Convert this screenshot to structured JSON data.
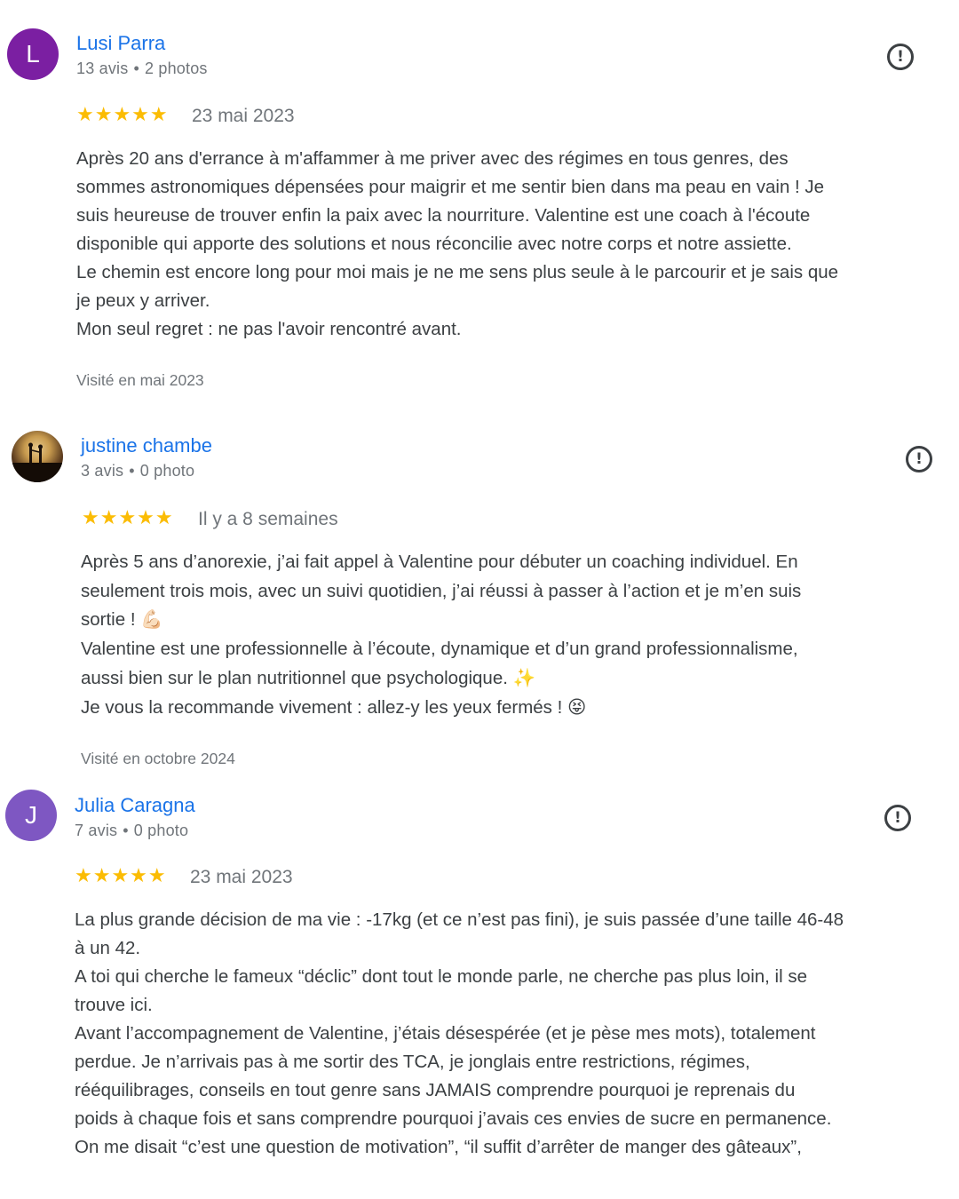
{
  "reviews": [
    {
      "avatar_letter": "L",
      "avatar_color": "#7b1fa2",
      "name": "Lusi Parra",
      "count": "13 avis",
      "photos": "2 photos",
      "stars": "★★★★★",
      "date": "23 mai 2023",
      "lines": [
        "Après 20 ans d'errance à m'affammer à me priver avec des régimes en tous genres, des",
        "sommes astronomiques dépensées pour maigrir et me sentir bien dans ma peau en vain ! Je",
        "suis heureuse de trouver enfin la paix avec la nourriture. Valentine est une coach à l'écoute",
        "disponible qui apporte des solutions et nous réconcilie avec notre corps et notre assiette.",
        "Le chemin est encore long pour moi mais je ne me sens plus seule à le parcourir et je sais que",
        "je peux y arriver.",
        "Mon seul regret : ne pas l'avoir rencontré avant."
      ],
      "visited": "Visité en mai 2023"
    },
    {
      "avatar_icon": "profile-photo",
      "name": "justine chambe",
      "count": "3 avis",
      "photos": "0 photo",
      "stars": "★★★★★",
      "date": "Il y a 8 semaines",
      "lines": [
        "Après 5 ans d’anorexie, j’ai fait appel à Valentine pour débuter un coaching individuel. En",
        "seulement trois mois, avec un suivi quotidien, j’ai réussi à passer à l’action et je m’en suis",
        "sortie ! 💪🏻",
        "Valentine est une professionnelle à l’écoute, dynamique et d’un grand professionnalisme,",
        "aussi bien sur le plan nutritionnel que psychologique. ✨",
        "Je vous la recommande vivement : allez-y les yeux fermés ! 😝"
      ],
      "visited": "Visité en octobre 2024"
    },
    {
      "avatar_letter": "J",
      "avatar_color": "#7e57c2",
      "name": "Julia Caragna",
      "count": "7 avis",
      "photos": "0 photo",
      "stars": "★★★★★",
      "date": "23 mai 2023",
      "lines": [
        "La plus grande décision de ma vie : -17kg (et ce n’est pas fini), je suis passée d’une taille 46-48",
        "à un 42.",
        "A toi qui cherche le fameux “déclic” dont tout le monde parle, ne cherche pas plus loin, il se",
        "trouve ici.",
        "Avant l’accompagnement de Valentine, j’étais désespérée (et je pèse mes mots), totalement",
        "perdue. Je n’arrivais pas à me sortir des TCA, je jonglais entre restrictions, régimes,",
        "rééquilibrages, conseils en tout genre sans JAMAIS comprendre pourquoi je reprenais du",
        "poids à chaque fois et sans comprendre pourquoi j’avais ces envies de sucre en permanence.",
        "On me disait “c’est une question de motivation”, “il suffit d’arrêter de manger des gâteaux”,"
      ],
      "visited": ""
    }
  ],
  "icons": {
    "report": "report-flag-icon",
    "star": "star-icon"
  },
  "colors": {
    "name": "#1a73e8",
    "star": "#fbbc04",
    "muted": "#70757a"
  }
}
